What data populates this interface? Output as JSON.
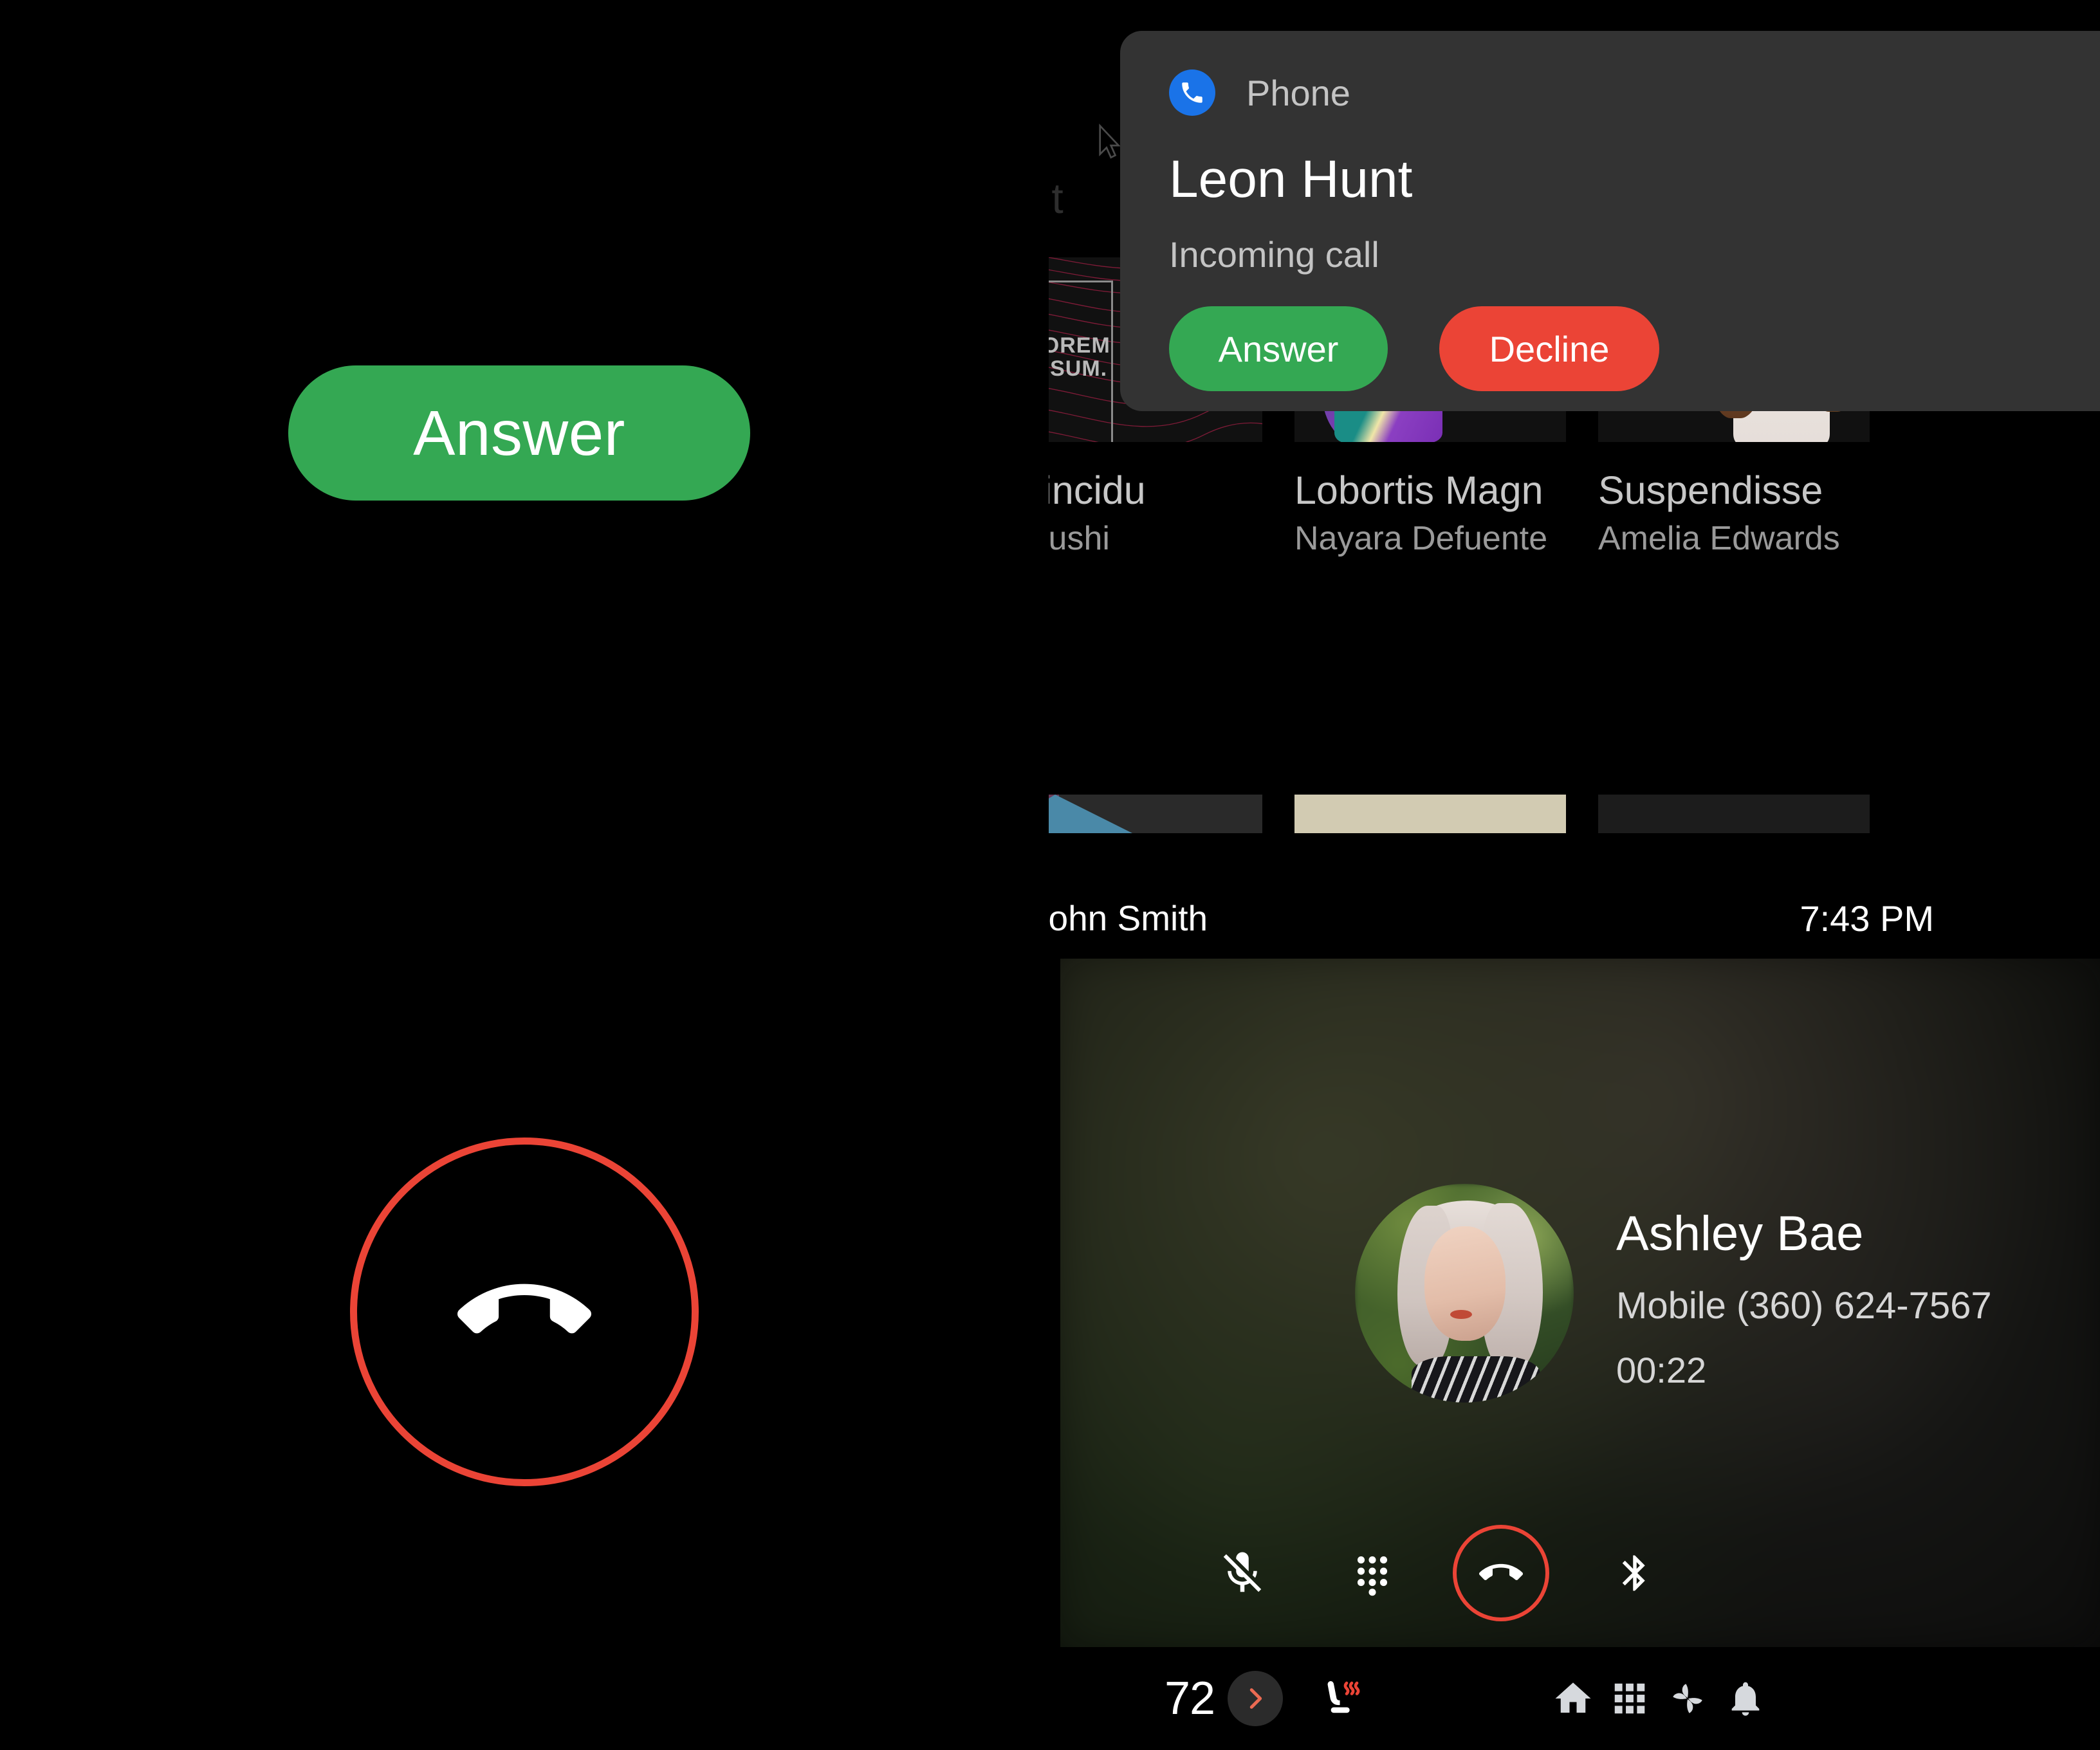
{
  "left_panel": {
    "answer_button": {
      "label": "Answer",
      "color": "#34a853",
      "icon": "answer-call-icon"
    },
    "end_call_button": {
      "icon": "end-call-icon",
      "color": "#eb4436"
    }
  },
  "notification": {
    "app_icon": "phone-icon",
    "app_name": "Phone",
    "caller_name": "Leon Hunt",
    "status": "Incoming call",
    "answer_label": "Answer",
    "decline_label": "Decline",
    "answer_color": "#34a853",
    "decline_color": "#eb4436",
    "card_color": "#333333"
  },
  "media": {
    "section_heading": "ent",
    "cards": [
      {
        "title": "s Tincidu",
        "artist": "i Ryushi",
        "art": "lorem-ipsum-topo-art",
        "art_text_line1": "LOREM",
        "art_text_line2": "IPSUM."
      },
      {
        "title": "Lobortis Magn",
        "artist": "Nayara Defuente",
        "art": "teal-purple-figure-art"
      },
      {
        "title": "Suspendisse",
        "artist": "Amelia Edwards",
        "art": "pink-figure-art"
      }
    ]
  },
  "strip": {
    "contact": "John Smith",
    "time": "7:43 PM"
  },
  "call": {
    "name": "Ashley Bae",
    "number": "Mobile (360) 624-7567",
    "duration": "00:22",
    "avatar": "contact-photo",
    "controls": [
      {
        "name": "mute-icon",
        "state": "muted"
      },
      {
        "name": "dialpad-icon"
      },
      {
        "name": "end-call-icon",
        "color": "#eb4436"
      },
      {
        "name": "bluetooth-icon"
      }
    ]
  },
  "system_bar": {
    "temperature": "72",
    "expand_icon": "chevron-right-icon",
    "expand_color": "#eb6a52",
    "seat_heater_icon": "heated-seat-icon",
    "nav": [
      {
        "icon": "home-icon"
      },
      {
        "icon": "apps-grid-icon"
      },
      {
        "icon": "climate-fan-icon"
      },
      {
        "icon": "notifications-bell-icon"
      }
    ]
  }
}
